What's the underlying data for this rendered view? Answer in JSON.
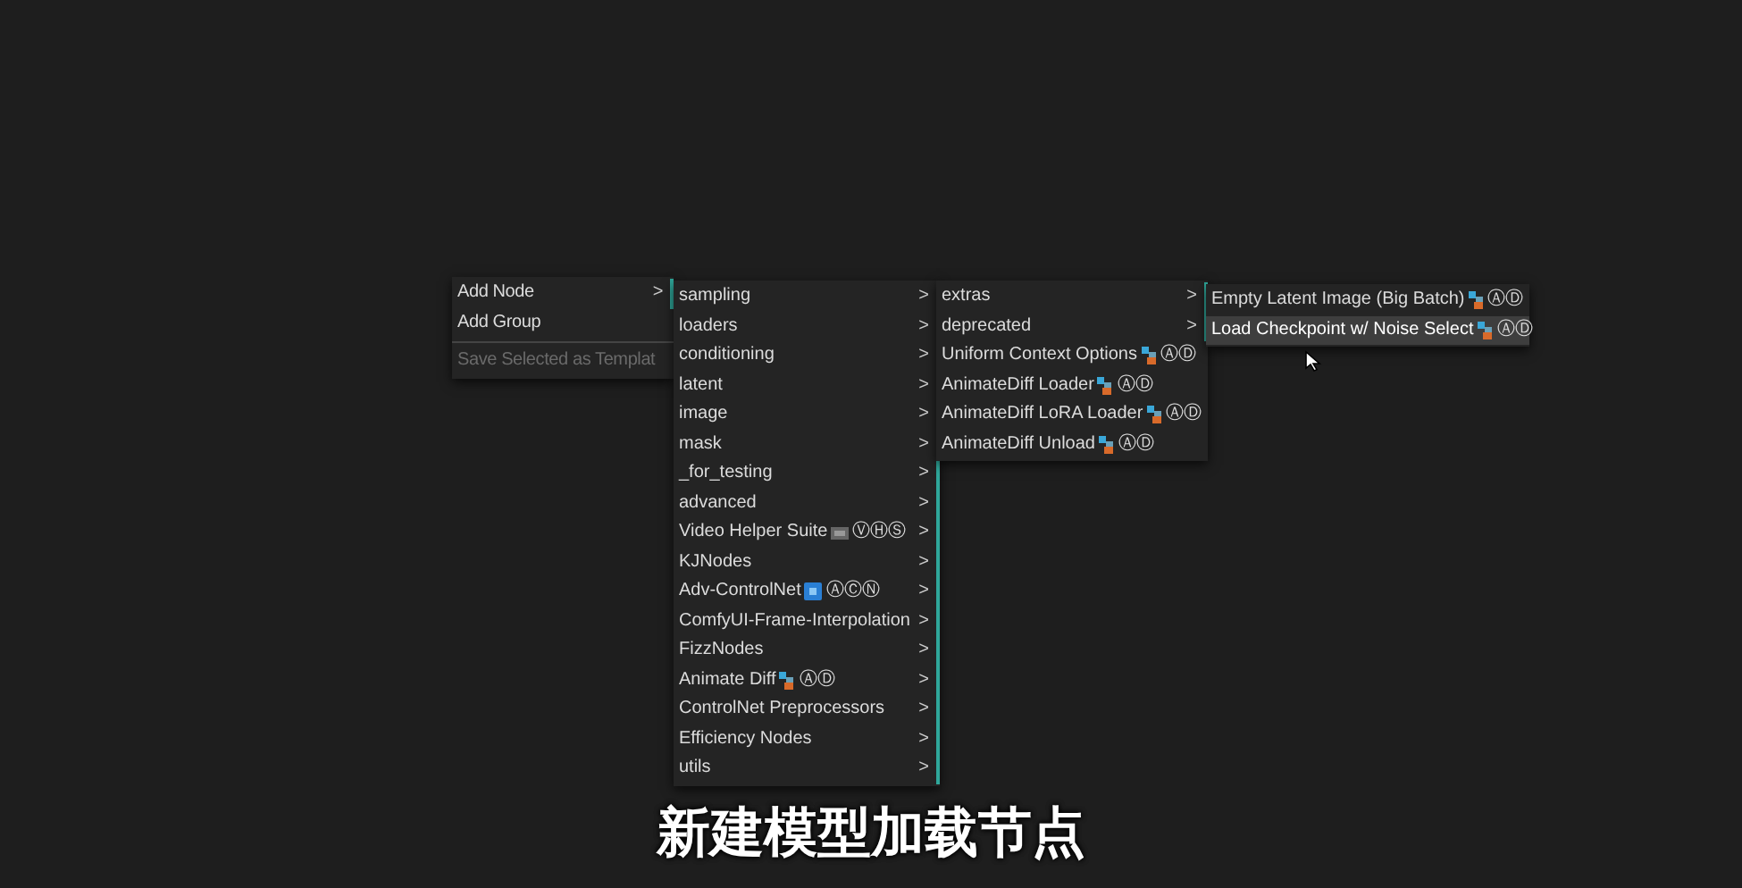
{
  "menus": [
    {
      "items": [
        {
          "label": "Add Node",
          "submenu": true,
          "disabled": false,
          "selected": false
        },
        {
          "label": "Add Group",
          "submenu": false,
          "disabled": false,
          "selected": false
        },
        {
          "label": "Save Selected as Templat",
          "submenu": false,
          "disabled": true,
          "selected": false,
          "separator_before": true
        }
      ]
    },
    {
      "items": [
        {
          "label": "sampling",
          "submenu": true,
          "selected": false
        },
        {
          "label": "loaders",
          "submenu": true,
          "selected": false
        },
        {
          "label": "conditioning",
          "submenu": true,
          "selected": false
        },
        {
          "label": "latent",
          "submenu": true,
          "selected": false
        },
        {
          "label": "image",
          "submenu": true,
          "selected": false
        },
        {
          "label": "mask",
          "submenu": true,
          "selected": false
        },
        {
          "label": "_for_testing",
          "submenu": true,
          "selected": false
        },
        {
          "label": "advanced",
          "submenu": true,
          "selected": false
        },
        {
          "label": "Video Helper Suite",
          "kind": "film",
          "badge": "ⓋⒽⓈ",
          "submenu": true,
          "selected": false
        },
        {
          "label": "KJNodes",
          "submenu": true,
          "selected": false
        },
        {
          "label": "Adv-ControlNet",
          "kind": "cube",
          "badge": "ⒶⒸⓃ",
          "submenu": true,
          "selected": false
        },
        {
          "label": "ComfyUI-Frame-Interpolation",
          "submenu": true,
          "selected": false
        },
        {
          "label": "FizzNodes",
          "submenu": true,
          "selected": false
        },
        {
          "label": "Animate Diff",
          "kind": "dots",
          "badge": "ⒶⒹ",
          "submenu": true,
          "selected": false
        },
        {
          "label": "ControlNet Preprocessors",
          "submenu": true,
          "selected": false
        },
        {
          "label": "Efficiency Nodes",
          "submenu": true,
          "selected": false
        },
        {
          "label": "utils",
          "submenu": true,
          "selected": false
        }
      ]
    },
    {
      "items": [
        {
          "label": "extras",
          "submenu": true,
          "selected": false
        },
        {
          "label": "deprecated",
          "submenu": true,
          "selected": false
        },
        {
          "label": "Uniform Context Options",
          "kind": "dots",
          "badge": "ⒶⒹ",
          "submenu": false,
          "selected": false
        },
        {
          "label": "AnimateDiff Loader",
          "kind": "dots",
          "badge": "ⒶⒹ",
          "submenu": false,
          "selected": false
        },
        {
          "label": "AnimateDiff LoRA Loader",
          "kind": "dots",
          "badge": "ⒶⒹ",
          "submenu": false,
          "selected": false
        },
        {
          "label": "AnimateDiff Unload",
          "kind": "dots",
          "badge": "ⒶⒹ",
          "submenu": false,
          "selected": false
        }
      ]
    },
    {
      "items": [
        {
          "label": "Empty Latent Image (Big Batch)",
          "kind": "dots",
          "badge": "ⒶⒹ",
          "submenu": false,
          "selected": false
        },
        {
          "label": "Load Checkpoint w/ Noise Select",
          "kind": "dots",
          "badge": "ⒶⒹ",
          "submenu": false,
          "selected": true
        }
      ]
    }
  ],
  "arrow": ">",
  "subtitle": "新建模型加载节点"
}
